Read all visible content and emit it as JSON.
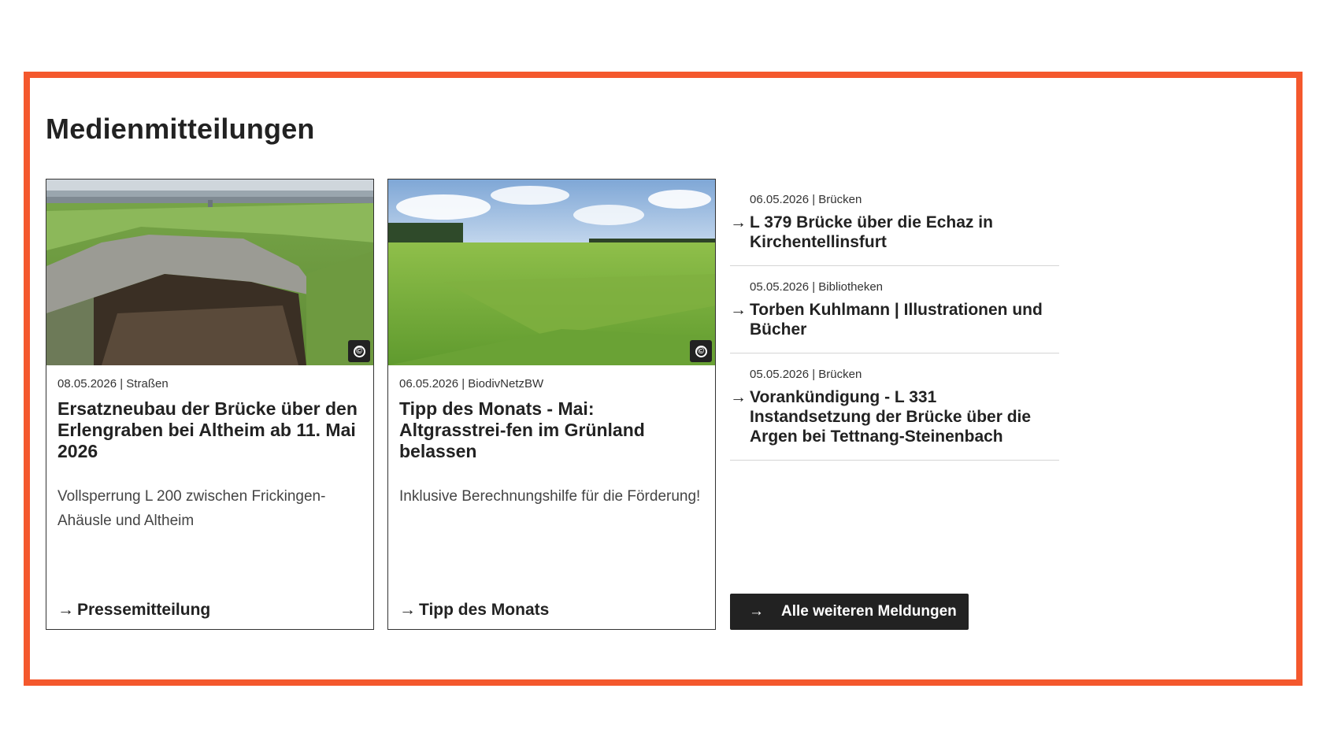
{
  "section": {
    "title": "Medienmitteilungen"
  },
  "cards": [
    {
      "meta": "08.05.2026 | Straßen",
      "title": "Ersatzneubau der Brücke über den Erlengraben bei Altheim ab 11. Mai 2026",
      "text": "Vollsperrung L 200 zwischen Frickingen-Ahäusle und Altheim",
      "link": "Pressemitteilung"
    },
    {
      "meta": "06.05.2026 | BiodivNetzBW",
      "title": "Tipp des Monats - Mai: Altgrasstrei-fen im Grünland belassen",
      "text": "Inklusive Berechnungshilfe für die Förderung!",
      "link": "Tipp des Monats"
    }
  ],
  "news": [
    {
      "meta": "06.05.2026 | Brücken",
      "title": "L 379 Brücke über die Echaz in Kirchentellinsfurt"
    },
    {
      "meta": "05.05.2026 | Bibliotheken",
      "title": "Torben Kuhlmann | Illustrationen und Bücher"
    },
    {
      "meta": "05.05.2026 | Brücken",
      "title": "Vorankündigung - L 331 Instandsetzung der Brücke über die Argen bei Tettnang-Steinenbach"
    }
  ],
  "all_button": {
    "label": "Alle weiteren Meldungen"
  },
  "icons": {
    "arrow": "→",
    "copyright": "©"
  },
  "colors": {
    "accent": "#f4582d",
    "text": "#222222",
    "button_bg": "#222222"
  }
}
